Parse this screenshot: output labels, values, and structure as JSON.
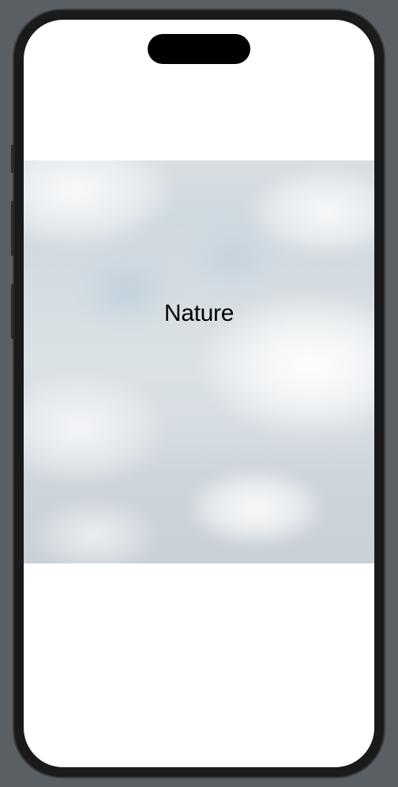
{
  "content": {
    "label": "Nature"
  }
}
